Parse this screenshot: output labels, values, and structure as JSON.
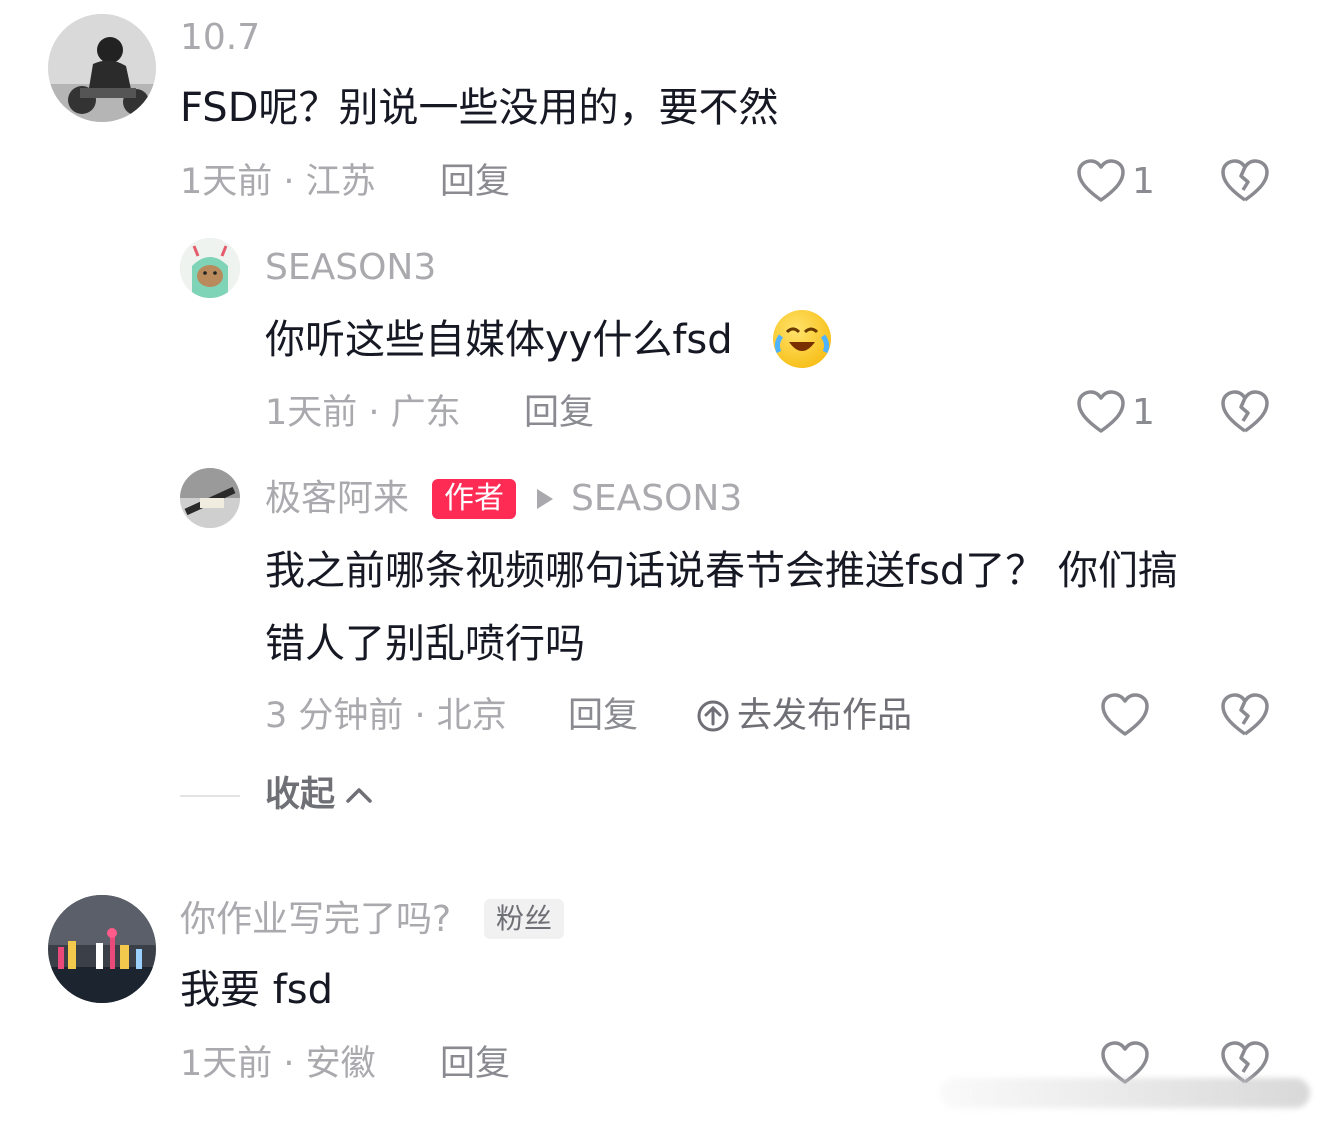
{
  "comments": [
    {
      "username": "10.7",
      "text": "FSD呢？别说一些没用的，要不然",
      "meta": "1天前 · 江苏",
      "reply_label": "回复",
      "like_count": "1",
      "like_icon": "heart-outline-icon",
      "dislike_icon": "broken-heart-icon"
    },
    {
      "username": "SEASON3",
      "text": "你听这些自媒体yy什么fsd",
      "emoji": "crying-laughing-emoji",
      "meta": "1天前 · 广东",
      "reply_label": "回复",
      "like_count": "1"
    },
    {
      "username": "极客阿来",
      "author_badge": "作者",
      "reply_to": "SEASON3",
      "text_line1": "我之前哪条视频哪句话说春节会推送fsd了？ 你们搞",
      "text_line2": "错人了别乱喷行吗",
      "meta": "3 分钟前 · 北京",
      "reply_label": "回复",
      "publish_label": "去发布作品"
    },
    {
      "username": "你作业写完了吗?",
      "fan_badge": "粉丝",
      "text": "我要 fsd",
      "meta": "1天前 · 安徽",
      "reply_label": "回复"
    }
  ],
  "collapse_label": "收起",
  "colors": {
    "author_badge": "#fe2c55",
    "muted_text": "#a9a9ae",
    "primary_text": "#161823"
  }
}
